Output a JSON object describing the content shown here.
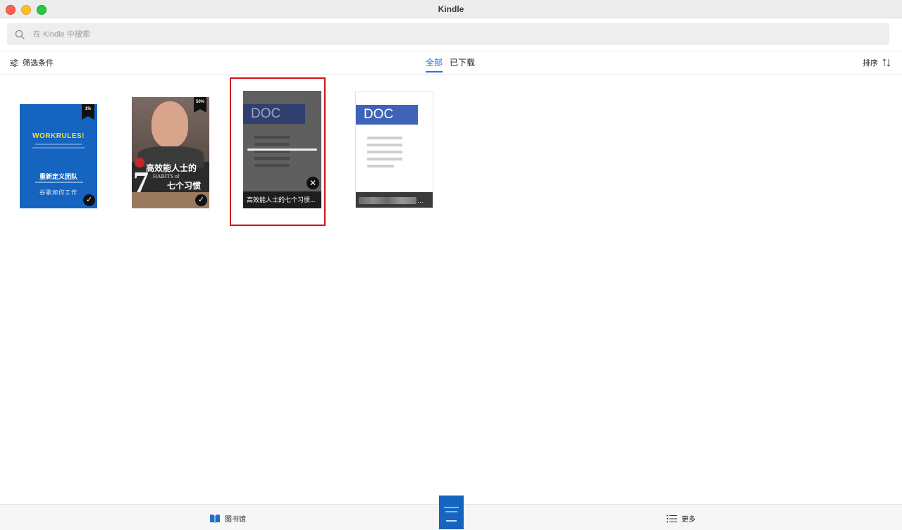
{
  "window": {
    "title": "Kindle"
  },
  "search": {
    "placeholder": "在 Kindle 中搜索"
  },
  "toolbar": {
    "filter_label": "筛选条件",
    "tabs": [
      {
        "label": "全部",
        "active": true
      },
      {
        "label": "已下载",
        "active": false
      }
    ],
    "sort_label": "排序"
  },
  "books": [
    {
      "cover_title": "WORKRULES!",
      "cover_title_cn": "重新定义团队",
      "cover_subtitle": "谷歌如何工作",
      "progress_badge": "1%",
      "downloaded": true
    },
    {
      "cover_title": "高效能人士的",
      "cover_title_2": "七个习惯",
      "cover_en_number": "7",
      "cover_en": "HABITS of",
      "progress_badge": "50%",
      "downloaded": true
    },
    {
      "doc_label": "DOC",
      "title": "高效能人士的七个习惯...",
      "downloading": true,
      "selected": true
    },
    {
      "doc_label": "DOC",
      "title": "...",
      "title_obscured": true
    }
  ],
  "bottom_nav": {
    "library_label": "图书馆",
    "more_label": "更多"
  },
  "colors": {
    "accent": "#1f7ad6",
    "selection_border": "#d0121b",
    "book1_blue": "#1565c0",
    "doc_blue": "#3f63b8"
  }
}
